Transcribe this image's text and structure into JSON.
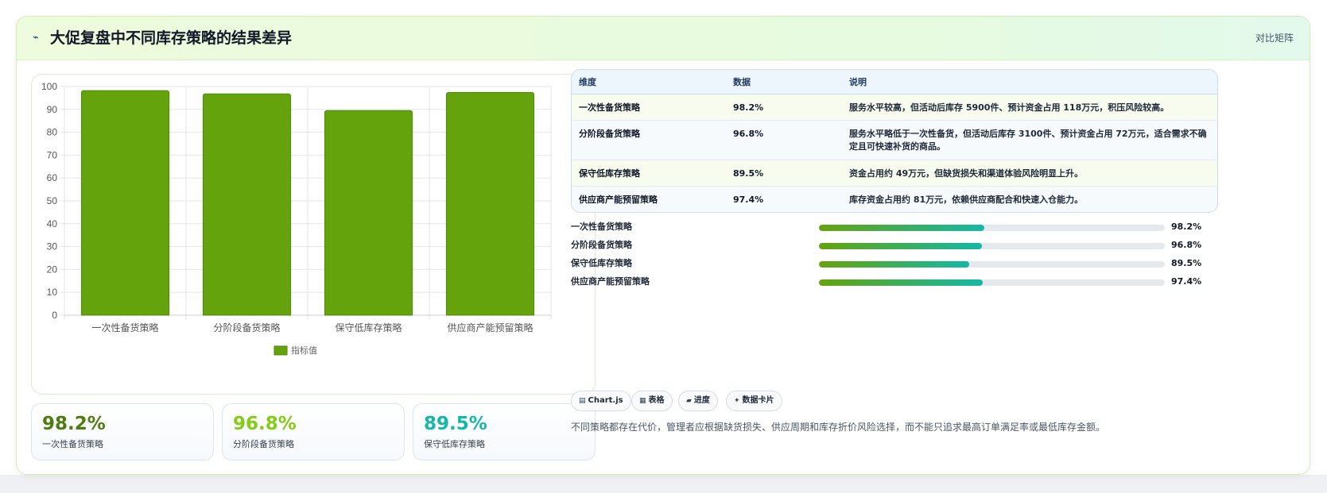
{
  "header": {
    "icon": "lightning-icon",
    "title": "大促复盘中不同库存策略的结果差异",
    "action_label": "对比矩阵"
  },
  "chart_data": {
    "type": "bar",
    "categories": [
      "一次性备货策略",
      "分阶段备货策略",
      "保守低库存策略",
      "供应商产能预留策略"
    ],
    "series": [
      {
        "name": "指标值",
        "values": [
          98.2,
          96.8,
          89.5,
          97.4
        ],
        "color": "#65a30d"
      }
    ],
    "title": "",
    "xlabel": "",
    "ylabel": "",
    "ylim": [
      0,
      100
    ],
    "yticks": [
      0,
      10,
      20,
      30,
      40,
      50,
      60,
      70,
      80,
      90,
      100
    ],
    "grid": true,
    "legend": "bottom"
  },
  "kpis": [
    {
      "value": "98.2%",
      "label": "一次性备货策略",
      "color": "#4d7c0f"
    },
    {
      "value": "96.8%",
      "label": "分阶段备货策略",
      "color": "#84cc16"
    },
    {
      "value": "89.5%",
      "label": "保守低库存策略",
      "color": "#14b8a6"
    }
  ],
  "table": {
    "headers": [
      "维度",
      "数据",
      "说明"
    ],
    "rows": [
      {
        "name": "一次性备货策略",
        "value": "98.2%",
        "desc": "服务水平较高，但活动后库存 5900件、预计资金占用 118万元，积压风险较高。"
      },
      {
        "name": "分阶段备货策略",
        "value": "96.8%",
        "desc": "服务水平略低于一次性备货，但活动后库存 3100件、预计资金占用 72万元，适合需求不确定且可快速补货的商品。"
      },
      {
        "name": "保守低库存策略",
        "value": "89.5%",
        "desc": "资金占用约 49万元，但缺货损失和渠道体验风险明显上升。"
      },
      {
        "name": "供应商产能预留策略",
        "value": "97.4%",
        "desc": "库存资金占用约 81万元，依赖供应商配合和快速入仓能力。"
      }
    ]
  },
  "progress": [
    {
      "label": "一次性备货策略",
      "value_text": "98.2%",
      "fill": 0.478
    },
    {
      "label": "分阶段备货策略",
      "value_text": "96.8%",
      "fill": 0.471
    },
    {
      "label": "保守低库存策略",
      "value_text": "89.5%",
      "fill": 0.435
    },
    {
      "label": "供应商产能预留策略",
      "value_text": "97.4%",
      "fill": 0.474
    }
  ],
  "tags": [
    {
      "icon": "chart-icon",
      "label": "Chart.js"
    },
    {
      "icon": "table-icon",
      "label": "表格"
    },
    {
      "icon": "progress-icon",
      "label": "进度"
    },
    {
      "icon": "sparkle-icon",
      "label": "数据卡片"
    }
  ],
  "footer": {
    "note": "不同策略都存在代价，管理者应根据缺货损失、供应周期和库存折价风险选择，而不能只追求最高订单满足率或最低库存金额。"
  }
}
